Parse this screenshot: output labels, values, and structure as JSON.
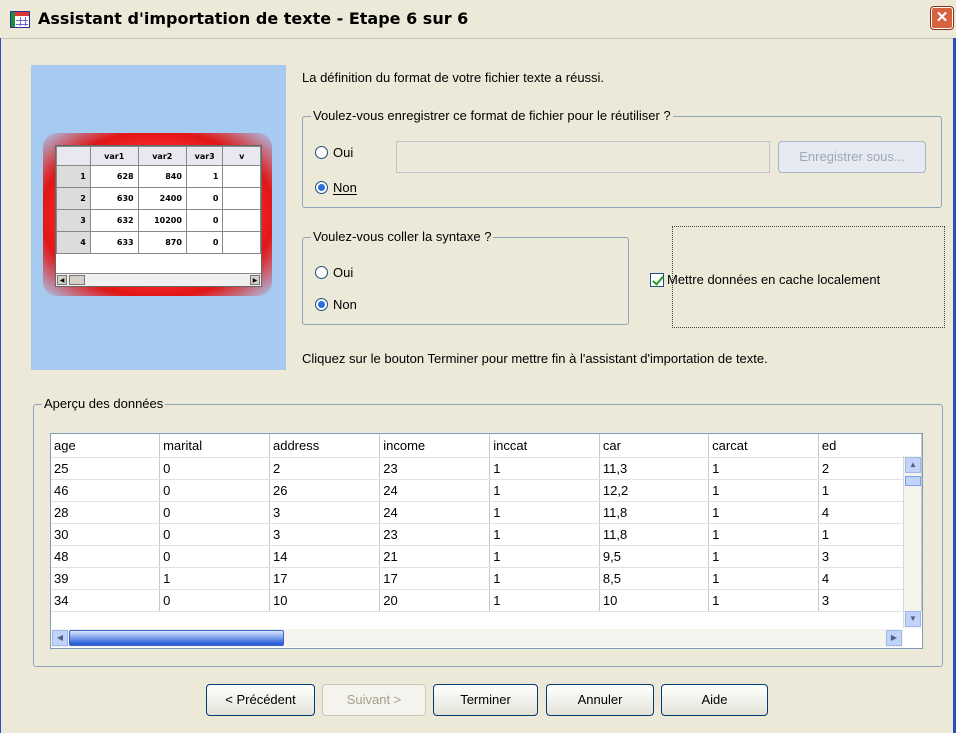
{
  "window": {
    "title": "Assistant d'importation de texte - Etape 6 sur 6",
    "close_glyph": "✕"
  },
  "preview_image": {
    "headers": [
      "",
      "var1",
      "var2",
      "var3",
      "v"
    ],
    "rows": [
      [
        "1",
        "628",
        "840",
        "1"
      ],
      [
        "2",
        "630",
        "2400",
        "0"
      ],
      [
        "3",
        "632",
        "10200",
        "0"
      ],
      [
        "4",
        "633",
        "870",
        "0"
      ]
    ]
  },
  "success_text": "La définition du format de votre fichier texte a réussi.",
  "save_format": {
    "legend": "Voulez-vous enregistrer ce format de fichier pour le réutiliser ?",
    "oui": "Oui",
    "non": "Non",
    "selected": "non",
    "save_button": "Enregistrer sous..."
  },
  "paste_syntax": {
    "legend": "Voulez-vous coller la syntaxe ?",
    "oui": "Oui",
    "non": "Non",
    "selected": "non"
  },
  "cache": {
    "label": "Mettre données en cache localement",
    "checked": true
  },
  "finish_text": "Cliquez sur le bouton Terminer pour mettre fin à l'assistant d'importation de texte.",
  "data_preview": {
    "legend": "Aperçu des données",
    "columns": [
      "age",
      "marital",
      "address",
      "income",
      "inccat",
      "car",
      "carcat",
      "ed"
    ],
    "rows": [
      [
        "25",
        "0",
        "2",
        "23",
        "1",
        "11,3",
        "1",
        "2"
      ],
      [
        "46",
        "0",
        "26",
        "24",
        "1",
        "12,2",
        "1",
        "1"
      ],
      [
        "28",
        "0",
        "3",
        "24",
        "1",
        "11,8",
        "1",
        "4"
      ],
      [
        "30",
        "0",
        "3",
        "23",
        "1",
        "11,8",
        "1",
        "1"
      ],
      [
        "48",
        "0",
        "14",
        "21",
        "1",
        "9,5",
        "1",
        "3"
      ],
      [
        "39",
        "1",
        "17",
        "17",
        "1",
        "8,5",
        "1",
        "4"
      ],
      [
        "34",
        "0",
        "10",
        "20",
        "1",
        "10",
        "1",
        "3"
      ]
    ]
  },
  "buttons": {
    "previous": "< Précédent",
    "next": "Suivant >",
    "finish": "Terminer",
    "cancel": "Annuler",
    "help": "Aide"
  },
  "colors": {
    "title_bar": "#ECE9D8",
    "preview_bg": "#A6CAF0",
    "dialog_bg": "#ECE9D8",
    "accent_blue": "#2B4FB5"
  }
}
